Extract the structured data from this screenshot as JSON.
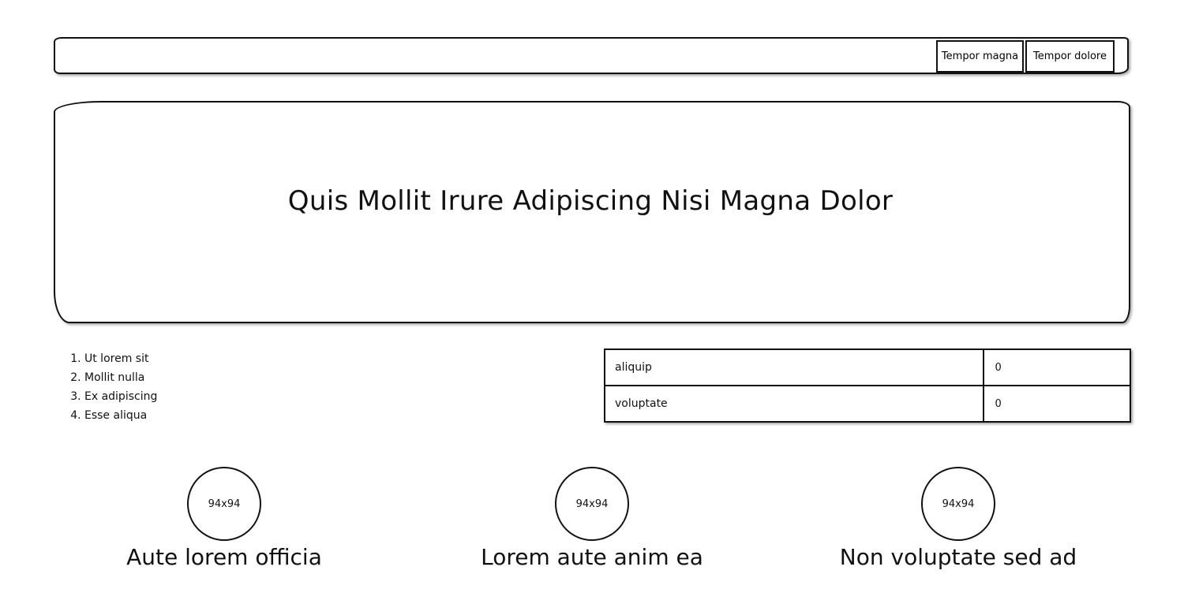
{
  "nav": {
    "buttons": [
      {
        "label": "Tempor magna"
      },
      {
        "label": "Tempor dolore"
      }
    ]
  },
  "hero": {
    "title": "Quis Mollit Irure Adipiscing Nisi Magna Dolor"
  },
  "list": {
    "items": [
      "Ut lorem sit",
      "Mollit nulla",
      "Ex adipiscing",
      "Esse aliqua"
    ]
  },
  "table": {
    "rows": [
      {
        "key": "aliquip",
        "value": "0"
      },
      {
        "key": "voluptate",
        "value": "0"
      }
    ]
  },
  "features": [
    {
      "image_label": "94x94",
      "caption": "Aute lorem officia"
    },
    {
      "image_label": "94x94",
      "caption": "Lorem aute anim ea"
    },
    {
      "image_label": "94x94",
      "caption": "Non voluptate sed ad"
    }
  ]
}
